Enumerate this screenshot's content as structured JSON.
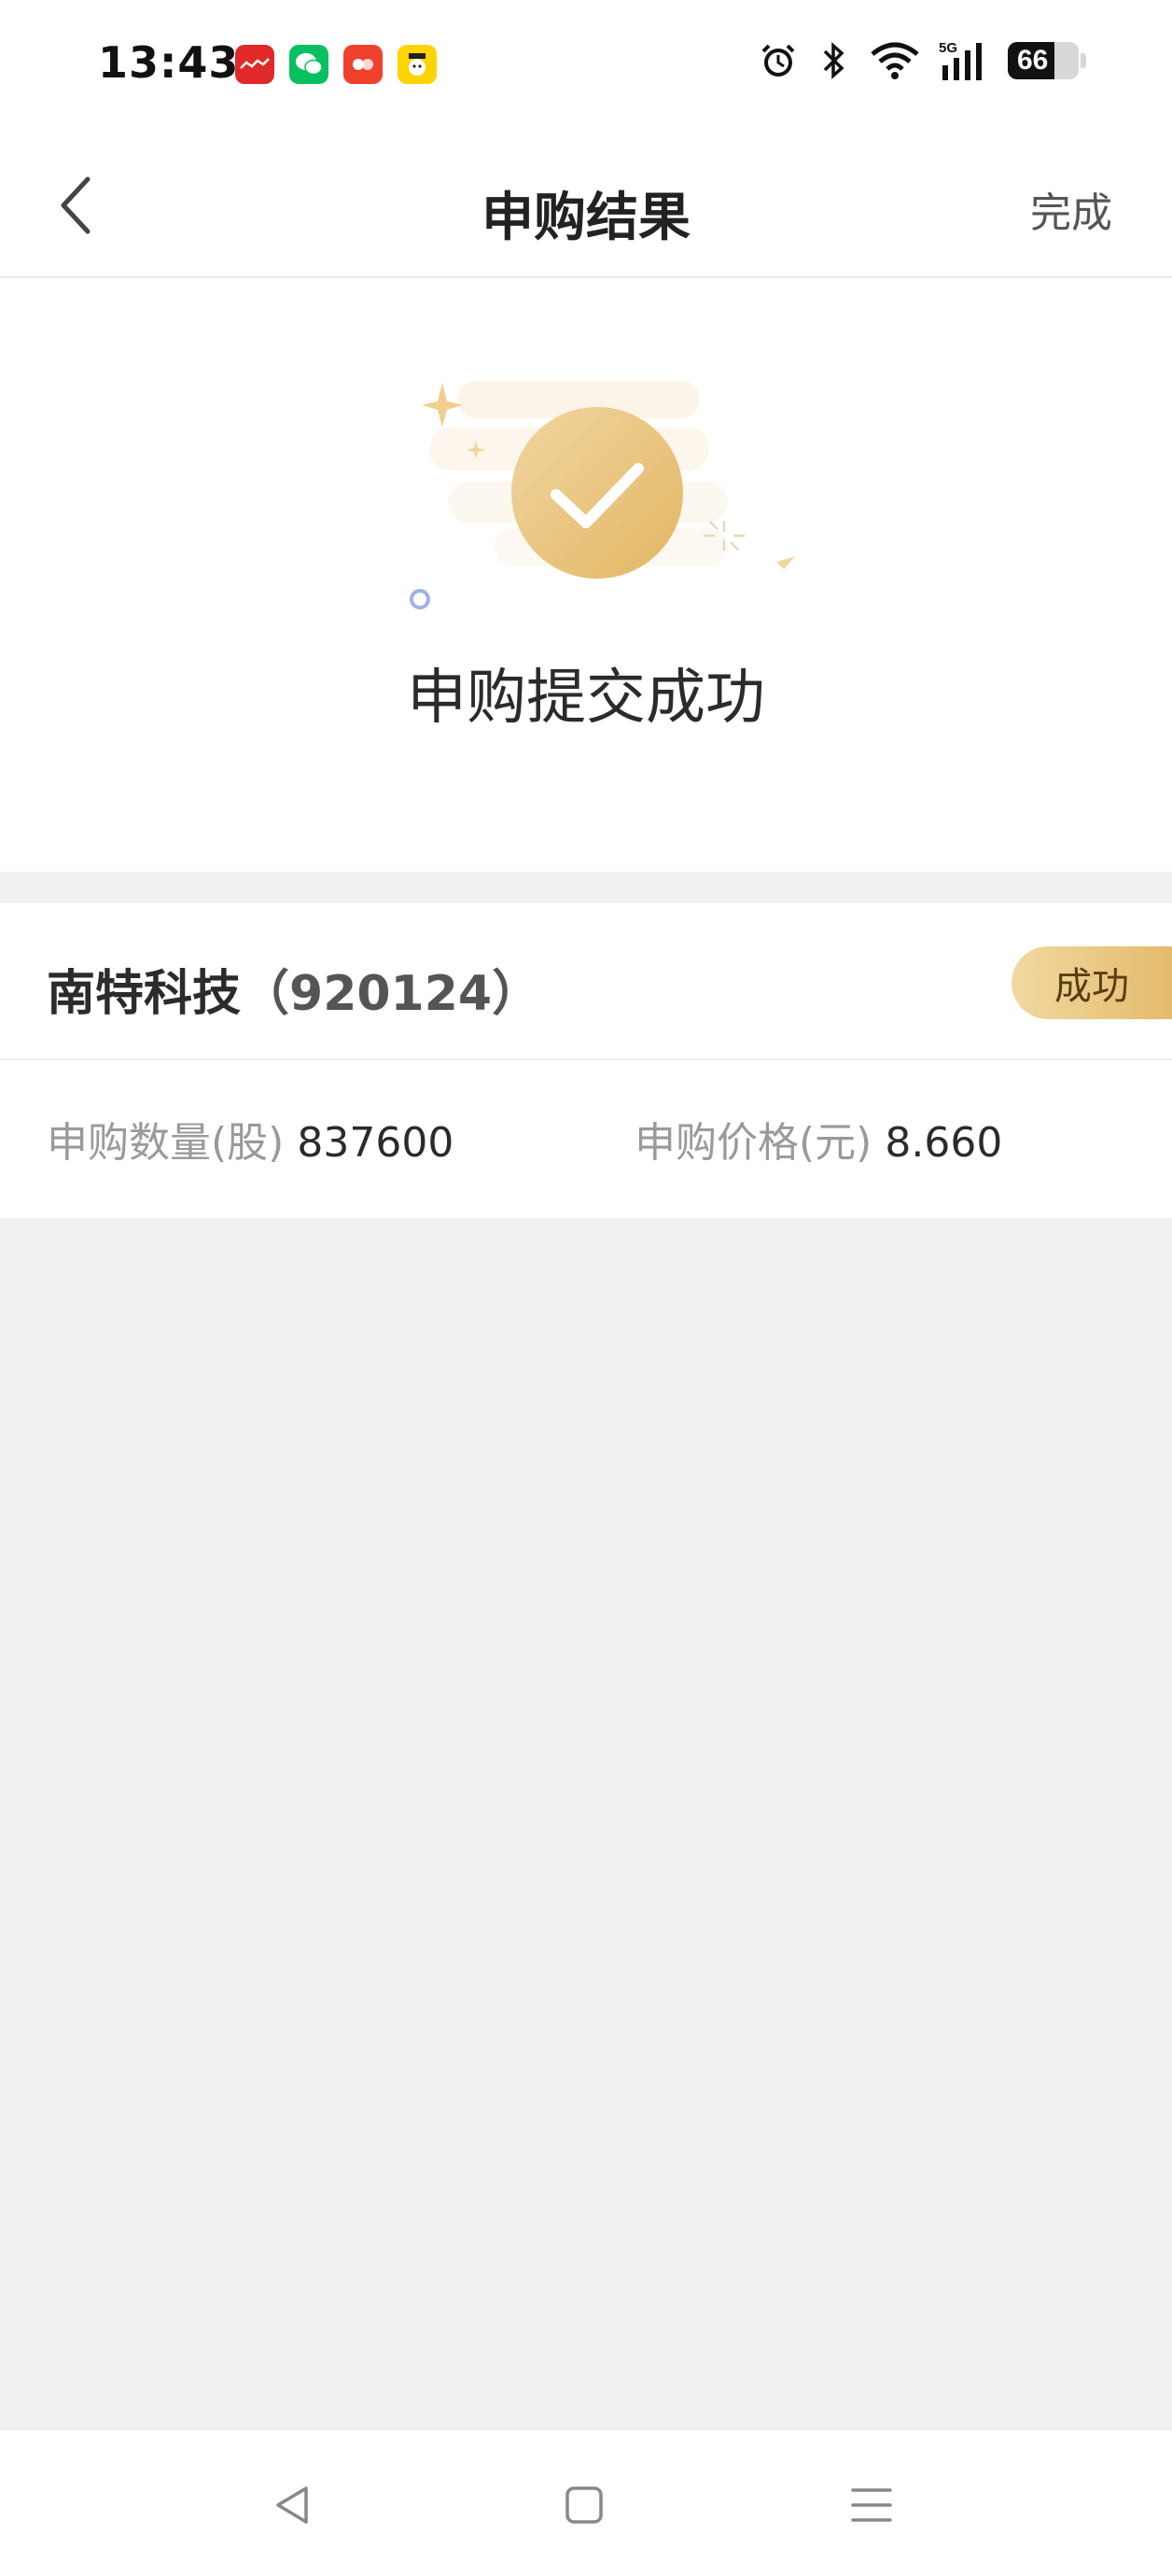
{
  "status_bar": {
    "time": "13:43",
    "battery_level": "66",
    "notification_icons": [
      "app-red-icon",
      "wechat-icon",
      "app-orange-icon",
      "app-yellow-icon"
    ],
    "system_icons": [
      "alarm-icon",
      "bluetooth-icon",
      "wifi-icon",
      "5g-signal-icon",
      "battery-icon"
    ],
    "network_label": "5G"
  },
  "nav": {
    "title": "申购结果",
    "done_label": "完成",
    "back_icon": "chevron-left-icon"
  },
  "result": {
    "icon": "check-circle-icon",
    "message": "申购提交成功",
    "accent_color": "#e4bb6d"
  },
  "stock": {
    "name": "南特科技",
    "code": "（920124）",
    "status": "成功",
    "quantity_label": "申购数量(股)",
    "quantity_value": "837600",
    "price_label": "申购价格(元)",
    "price_value": "8.660"
  },
  "system_nav": {
    "icons": [
      "back-triangle-icon",
      "home-square-icon",
      "menu-lines-icon"
    ]
  }
}
